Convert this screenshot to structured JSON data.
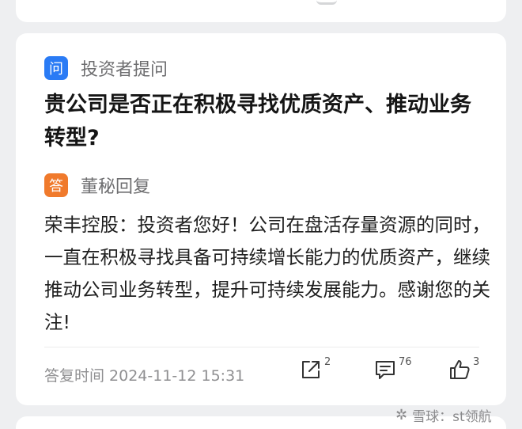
{
  "question_header": {
    "badge": "问",
    "label": "投资者提问"
  },
  "question_text": "贵公司是否正在积极寻找优质资产、推动业务转型?",
  "answer_header": {
    "badge": "答",
    "label": "董秘回复"
  },
  "answer_text": "荣丰控股：投资者您好！公司在盘活存量资源的同时，一直在积极寻找具备可持续增长能力的优质资产，继续推动公司业务转型，提升可持续发展能力。感谢您的关注!",
  "footer": {
    "time_label": "答复时间 2024-11-12 15:31",
    "share_count": "2",
    "comment_count": "76",
    "like_count": "3"
  },
  "watermark": {
    "icon": "snowball-icon",
    "text": "雪球：st领航"
  },
  "colors": {
    "question_badge": "#2a7bf5",
    "answer_badge": "#f07a2c",
    "background": "#eeeff1"
  }
}
